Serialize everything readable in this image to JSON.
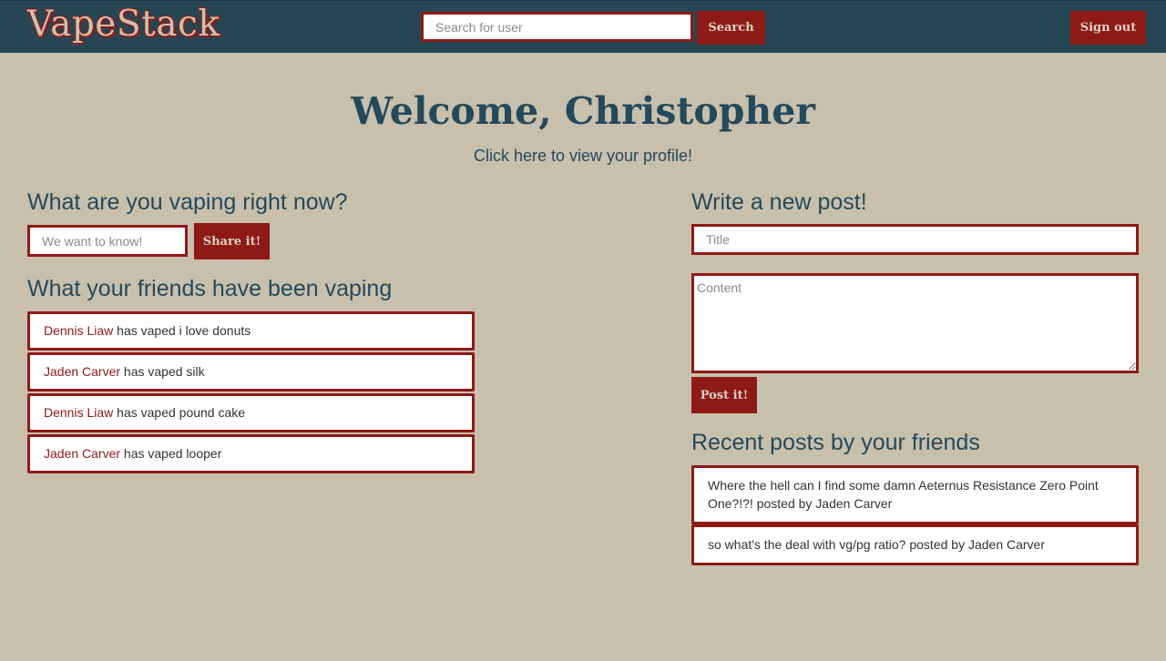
{
  "nav": {
    "brand": "VapeStack",
    "search_placeholder": "Search for user",
    "search_label": "Search",
    "signout_label": "Sign out"
  },
  "header": {
    "welcome": "Welcome, Christopher",
    "profile_link": "Click here to view your profile!"
  },
  "vaping": {
    "heading": "What are you vaping right now?",
    "input_placeholder": "We want to know!",
    "share_label": "Share it!"
  },
  "friends_vaping": {
    "heading": "What your friends have been vaping",
    "items": [
      {
        "friend": "Dennis Liaw",
        "text": " has vaped i love donuts"
      },
      {
        "friend": "Jaden Carver",
        "text": " has vaped silk"
      },
      {
        "friend": "Dennis Liaw",
        "text": " has vaped pound cake"
      },
      {
        "friend": "Jaden Carver",
        "text": " has vaped looper"
      }
    ]
  },
  "new_post": {
    "heading": "Write a new post!",
    "title_placeholder": "Title",
    "content_placeholder": "Content",
    "post_label": "Post it!"
  },
  "recent_posts": {
    "heading": "Recent posts by your friends",
    "items": [
      {
        "text": "Where the hell can I find some damn Aeternus Resistance Zero Point One?!?! posted by Jaden Carver"
      },
      {
        "text": "so what's the deal with vg/pg ratio? posted by Jaden Carver"
      }
    ]
  },
  "colors": {
    "navbar": "#264653",
    "accent": "#8e1a17",
    "background": "#c8c0ad",
    "text": "#24495a"
  }
}
